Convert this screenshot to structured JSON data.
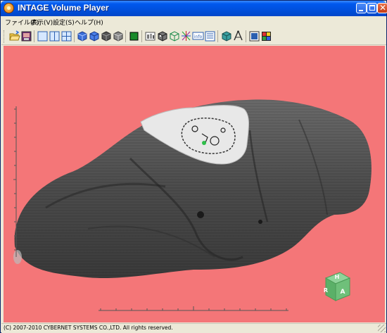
{
  "window": {
    "title": "INTAGE Volume Player"
  },
  "menu": {
    "items": [
      "ファイル(F)",
      "表示(V)",
      "設定(S)",
      "ヘルプ(H)"
    ]
  },
  "toolbar": {
    "buttons": [
      {
        "name": "open-file-icon"
      },
      {
        "name": "save-image-icon"
      },
      {
        "name": "layout-single-view-icon"
      },
      {
        "name": "layout-two-view-icon"
      },
      {
        "name": "layout-four-view-icon"
      },
      {
        "name": "render-mode-1-icon"
      },
      {
        "name": "render-mode-2-icon"
      },
      {
        "name": "render-mode-3-icon"
      },
      {
        "name": "render-mode-4-icon"
      },
      {
        "name": "background-color-icon"
      },
      {
        "name": "clip-plane-icon"
      },
      {
        "name": "volume-box-icon"
      },
      {
        "name": "wireframe-box-icon"
      },
      {
        "name": "light-icon"
      },
      {
        "name": "info-icon"
      },
      {
        "name": "properties-panel-icon"
      },
      {
        "name": "orientation-cube-icon"
      },
      {
        "name": "measure-icon"
      },
      {
        "name": "screenshot-icon"
      },
      {
        "name": "color-palette-icon"
      }
    ]
  },
  "viewport": {
    "background_color": "#f47678",
    "orientation_cube": {
      "labels": {
        "top": "H",
        "left": "R",
        "front": "A"
      },
      "color": "#6fc07a"
    }
  },
  "status": {
    "text": "(C) 2007-2010 CYBERNET SYSTEMS CO.,LTD. All rights reserved."
  }
}
